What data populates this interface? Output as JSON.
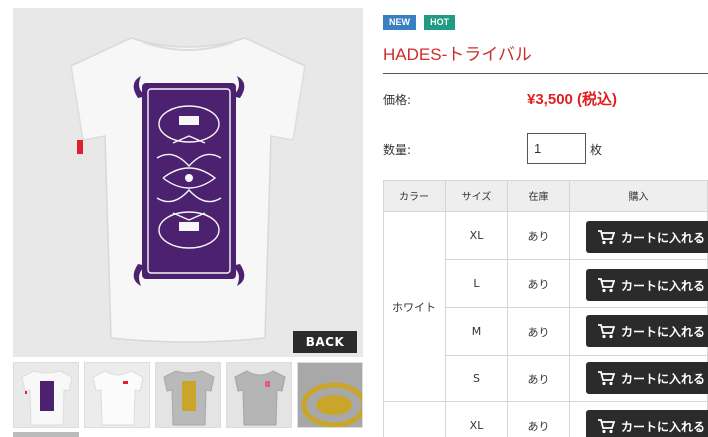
{
  "gallery": {
    "back_label": "BACK",
    "thumbnails": [
      {
        "name": "white-back"
      },
      {
        "name": "white-front"
      },
      {
        "name": "gray-back"
      },
      {
        "name": "gray-front"
      },
      {
        "name": "print-closeup"
      }
    ],
    "colors": {
      "background": "#e8e8e8",
      "shirt_white": "#f7f7f7",
      "shirt_gray": "#b9b9b9",
      "print_purple": "#4b2170",
      "print_gold": "#c9a62a",
      "tag_red": "#e0202a"
    }
  },
  "product": {
    "badges": [
      {
        "label": "NEW",
        "color": "#3a7fc1"
      },
      {
        "label": "HOT",
        "color": "#1e9c84"
      }
    ],
    "title": "HADES-トライバル",
    "price_label": "価格:",
    "price": "¥3,500 (税込)",
    "quantity_label": "数量:",
    "quantity_value": "1",
    "quantity_unit": "枚",
    "title_color": "#cc2b2b",
    "price_color": "#e02020"
  },
  "variants": {
    "headers": [
      "カラー",
      "サイズ",
      "在庫",
      "購入"
    ],
    "color_group": "ホワイト",
    "rows": [
      {
        "size": "XL",
        "stock": "あり",
        "button": "カートに入れる"
      },
      {
        "size": "L",
        "stock": "あり",
        "button": "カートに入れる"
      },
      {
        "size": "M",
        "stock": "あり",
        "button": "カートに入れる"
      },
      {
        "size": "S",
        "stock": "あり",
        "button": "カートに入れる"
      },
      {
        "size": "XL",
        "stock": "あり",
        "button": "カートに入れる"
      }
    ],
    "button_color": "#2b2b2b",
    "cart_icon": "cart-icon"
  }
}
